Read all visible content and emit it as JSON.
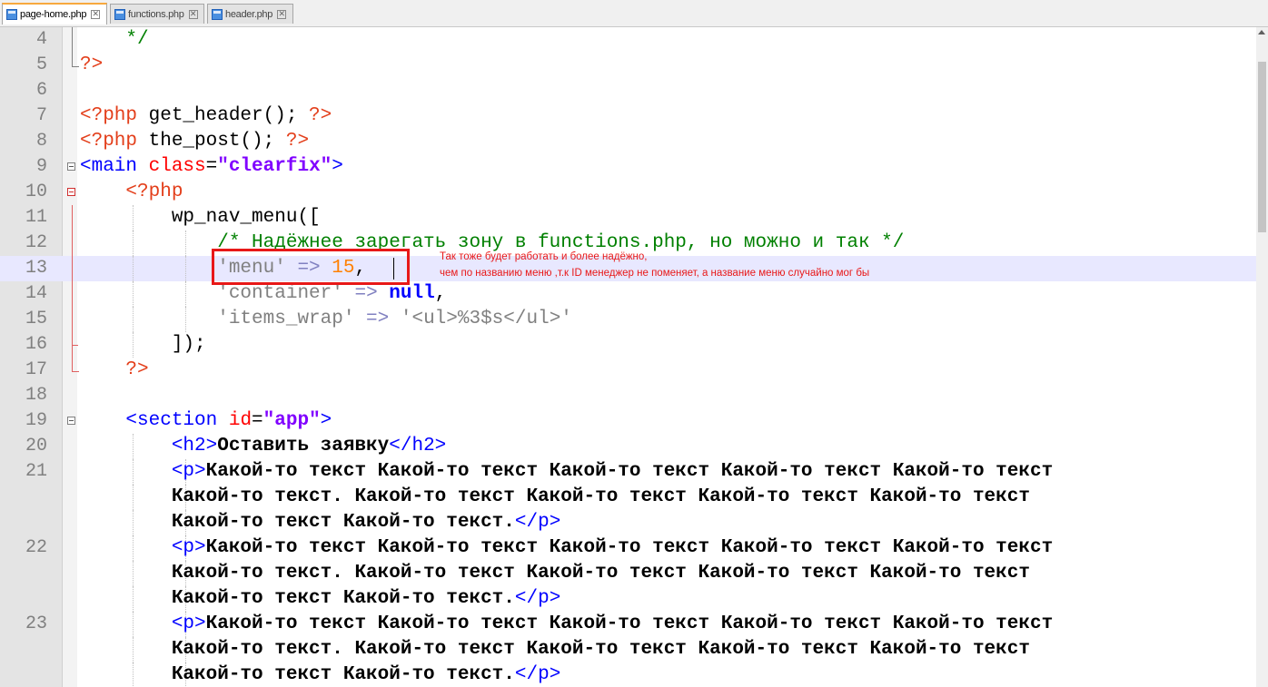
{
  "tabs": [
    {
      "label": "page-home.php",
      "active": true
    },
    {
      "label": "functions.php",
      "active": false
    },
    {
      "label": "header.php",
      "active": false
    }
  ],
  "tab_close_glyph": "✕",
  "colors": {
    "php_delim": "#e33e1a",
    "comment": "#008000",
    "string": "#808080",
    "number": "#ff8000",
    "keyword": "#0000ff",
    "html_tag": "#0000ff",
    "attribute": "#ff0000",
    "attribute_value": "#8000ff",
    "annotation": "#e81818",
    "current_line_bg": "#e8e8ff"
  },
  "annotation": {
    "line1": "Так тоже будет работать и более надёжно,",
    "line2": "чем по названию меню ,т.к ID менеджер не поменяет, а название меню случайно мог бы"
  },
  "lines": [
    {
      "n": "4",
      "tokens": [
        [
          "    */",
          "t-cmt"
        ]
      ]
    },
    {
      "n": "5",
      "tokens": [
        [
          "?>",
          "t-php"
        ]
      ]
    },
    {
      "n": "6",
      "tokens": []
    },
    {
      "n": "7",
      "tokens": [
        [
          "<?php",
          "t-php"
        ],
        [
          " get_header",
          "t-fn"
        ],
        [
          "();",
          "t-pun"
        ],
        [
          " ?>",
          "t-php"
        ]
      ]
    },
    {
      "n": "8",
      "tokens": [
        [
          "<?php",
          "t-php"
        ],
        [
          " the_post",
          "t-fn"
        ],
        [
          "();",
          "t-pun"
        ],
        [
          " ?>",
          "t-php"
        ]
      ]
    },
    {
      "n": "9",
      "tokens": [
        [
          "<main",
          "t-tag"
        ],
        [
          " class",
          "t-attr"
        ],
        [
          "=",
          "t-plain"
        ],
        [
          "\"clearfix\"",
          "t-attrv"
        ],
        [
          ">",
          "t-tag"
        ]
      ]
    },
    {
      "n": "10",
      "tokens": [
        [
          "    <?php",
          "t-php"
        ]
      ]
    },
    {
      "n": "11",
      "tokens": [
        [
          "        wp_nav_menu",
          "t-fn"
        ],
        [
          "([",
          "t-pun"
        ]
      ]
    },
    {
      "n": "12",
      "tokens": [
        [
          "            /* Надёжнее зарегать зону в functions.php, но можно и так */",
          "t-cmt"
        ]
      ]
    },
    {
      "n": "13",
      "tokens": [
        [
          "            'menu'",
          "t-str"
        ],
        [
          " =>",
          "t-op"
        ],
        [
          " 15",
          "t-num"
        ],
        [
          ",",
          "t-pun"
        ]
      ]
    },
    {
      "n": "14",
      "tokens": [
        [
          "            'container'",
          "t-str"
        ],
        [
          " =>",
          "t-op"
        ],
        [
          " null",
          "t-kw"
        ],
        [
          ",",
          "t-pun"
        ]
      ]
    },
    {
      "n": "15",
      "tokens": [
        [
          "            'items_wrap'",
          "t-str"
        ],
        [
          " =>",
          "t-op"
        ],
        [
          " '<ul>%3$s</ul>'",
          "t-str"
        ]
      ]
    },
    {
      "n": "16",
      "tokens": [
        [
          "        ]);",
          "t-pun"
        ]
      ]
    },
    {
      "n": "17",
      "tokens": [
        [
          "    ?>",
          "t-php"
        ]
      ]
    },
    {
      "n": "18",
      "tokens": []
    },
    {
      "n": "19",
      "tokens": [
        [
          "    <section",
          "t-tag"
        ],
        [
          " id",
          "t-attr"
        ],
        [
          "=",
          "t-plain"
        ],
        [
          "\"app\"",
          "t-attrv"
        ],
        [
          ">",
          "t-tag"
        ]
      ]
    },
    {
      "n": "20",
      "tokens": [
        [
          "        <h2>",
          "t-tag"
        ],
        [
          "Оставить заявку",
          "t-bold"
        ],
        [
          "</h2>",
          "t-tag"
        ]
      ]
    },
    {
      "n": "21",
      "tokens": [
        [
          "        <p>",
          "t-tag"
        ],
        [
          "Какой-то текст Какой-то текст Какой-то текст Какой-то текст Какой-то текст",
          "t-bold"
        ]
      ]
    },
    {
      "n": "",
      "tokens": [
        [
          "        Какой-то текст. Какой-то текст Какой-то текст Какой-то текст Какой-то текст",
          "t-bold"
        ]
      ]
    },
    {
      "n": "",
      "tokens": [
        [
          "        Какой-то текст Какой-то текст.",
          "t-bold"
        ],
        [
          "</p>",
          "t-tag"
        ]
      ]
    },
    {
      "n": "22",
      "tokens": [
        [
          "        <p>",
          "t-tag"
        ],
        [
          "Какой-то текст Какой-то текст Какой-то текст Какой-то текст Какой-то текст",
          "t-bold"
        ]
      ]
    },
    {
      "n": "",
      "tokens": [
        [
          "        Какой-то текст. Какой-то текст Какой-то текст Какой-то текст Какой-то текст",
          "t-bold"
        ]
      ]
    },
    {
      "n": "",
      "tokens": [
        [
          "        Какой-то текст Какой-то текст.",
          "t-bold"
        ],
        [
          "</p>",
          "t-tag"
        ]
      ]
    },
    {
      "n": "23",
      "tokens": [
        [
          "        <p>",
          "t-tag"
        ],
        [
          "Какой-то текст Какой-то текст Какой-то текст Какой-то текст Какой-то текст",
          "t-bold"
        ]
      ]
    },
    {
      "n": "",
      "tokens": [
        [
          "        Какой-то текст. Какой-то текст Какой-то текст Какой-то текст Какой-то текст",
          "t-bold"
        ]
      ]
    },
    {
      "n": "",
      "tokens": [
        [
          "        Какой-то текст Какой-то текст.",
          "t-bold"
        ],
        [
          "</p>",
          "t-tag"
        ]
      ]
    }
  ]
}
